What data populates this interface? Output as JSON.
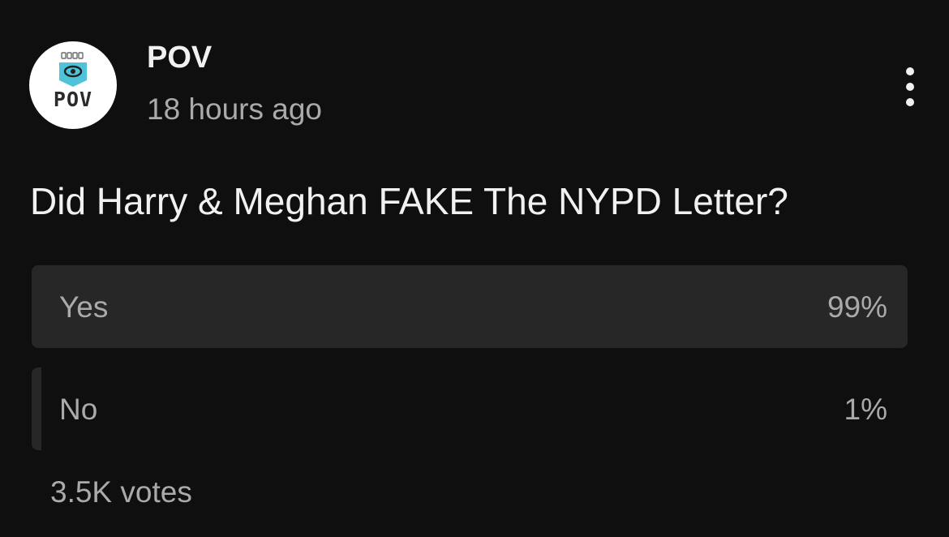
{
  "post": {
    "channel_name": "POV",
    "channel_logo_text": "POV",
    "time": "18 hours ago",
    "menu_icon": "more-vertical-icon",
    "question": "Did Harry & Meghan FAKE The NYPD Letter?"
  },
  "poll": {
    "options": [
      {
        "label": "Yes",
        "percent_label": "99%",
        "share": 0.99
      },
      {
        "label": "No",
        "percent_label": "1%",
        "share": 0.01
      }
    ],
    "votes": "3.5K votes"
  },
  "colors": {
    "background": "#0f0f0f",
    "bar_fill": "#272727",
    "primary_text": "#f1f1f1",
    "secondary_text": "#aaaaaa",
    "logo_accent": "#4fc3d9"
  }
}
